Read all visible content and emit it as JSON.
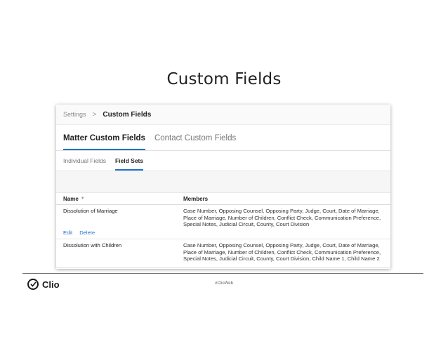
{
  "slide": {
    "title": "Custom Fields",
    "hashtag": "#ClioWeb",
    "brand": "Clio"
  },
  "breadcrumb": {
    "parent": "Settings",
    "separator": ">",
    "current": "Custom Fields"
  },
  "tabs": [
    {
      "label": "Matter Custom Fields",
      "active": true
    },
    {
      "label": "Contact Custom Fields",
      "active": false
    }
  ],
  "subtabs": [
    {
      "label": "Individual Fields",
      "active": false
    },
    {
      "label": "Field Sets",
      "active": true
    }
  ],
  "table": {
    "columns": [
      "Name",
      "Members"
    ],
    "rows": [
      {
        "name": "Dissolution of Marriage",
        "members": [
          "Case Number, Opposing Counsel, Opposing Party, Judge, Court, Date of Marriage,",
          "Place of Marriage, Number of Children, Conflict Check, Communication Preference,",
          "Special Notes, Judicial Circuit, County, Court Division"
        ],
        "actions": [
          "Edit",
          "Delete"
        ]
      },
      {
        "name": "Dissolution with Children",
        "members": [
          "Case Number, Opposing Counsel, Opposing Party, Judge, Court, Date of Marriage,",
          "Place of Marriage, Number of Children, Conflict Check, Communication Preference,",
          "Special Notes, Judicial Circuit, County, Court Division, Child Name 1, Child Name 2"
        ]
      }
    ]
  },
  "colors": {
    "accent": "#1f72c8",
    "text": "#222222"
  }
}
